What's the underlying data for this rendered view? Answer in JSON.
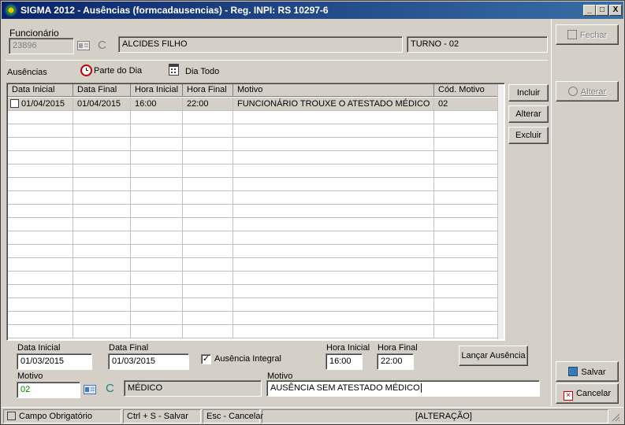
{
  "window": {
    "title": "SIGMA 2012 - Ausências  (formcadausencias) - Reg. INPI: RS 10297-6",
    "minimize": "_",
    "maximize": "□",
    "close": "X"
  },
  "funcionario": {
    "label": "Funcionário",
    "code": "23896",
    "name": "ALCIDES FILHO",
    "turno": "TURNO - 02"
  },
  "toolbar": {
    "ausencias_label": "Ausências",
    "parte_do_dia_label": "Parte do Dia",
    "dia_todo_label": "Dia Todo"
  },
  "grid": {
    "columns": [
      "Data Inicial",
      "Data Final",
      "Hora Inicial",
      "Hora Final",
      "Motivo",
      "Cód. Motivo"
    ],
    "rows": [
      [
        "01/04/2015",
        "01/04/2015",
        "16:00",
        "22:00",
        "FUNCIONÁRIO TROUXE O ATESTADO MÉDICO",
        "02"
      ]
    ]
  },
  "grid_buttons": {
    "incluir": "Incluir",
    "alterar": "Alterar",
    "excluir": "Excluir"
  },
  "form": {
    "data_inicial_label": "Data Inicial",
    "data_inicial_value": "01/03/2015",
    "data_final_label": "Data Final",
    "data_final_value": "01/03/2015",
    "ausencia_integral_label": "Ausência Integral",
    "ausencia_integral_checked": true,
    "hora_inicial_label": "Hora Inicial",
    "hora_inicial_value": "16:00",
    "hora_final_label": "Hora Final",
    "hora_final_value": "22:00",
    "lancar_label": "Lançar Ausência",
    "motivo_label": "Motivo",
    "motivo_code": "02",
    "motivo_name": "MÉDICO",
    "motivo2_label": "Motivo",
    "motivo_text": "AUSÊNCIA SEM ATESTADO MÉDICO"
  },
  "side": {
    "fechar": "Fechar",
    "alterar": "Alterar",
    "salvar": "Salvar",
    "cancelar": "Cancelar"
  },
  "statusbar": {
    "campo_obrigatorio": "Campo Obrigatório",
    "salvar_hint": "Ctrl + S - Salvar",
    "cancelar_hint": "Esc - Cancelar",
    "mode": "[ALTERAÇÃO]"
  },
  "colors": {
    "title_start": "#0a246a",
    "title_end": "#3a6ea5",
    "face": "#d4d0c8",
    "motivo_code_color": "#008000"
  }
}
